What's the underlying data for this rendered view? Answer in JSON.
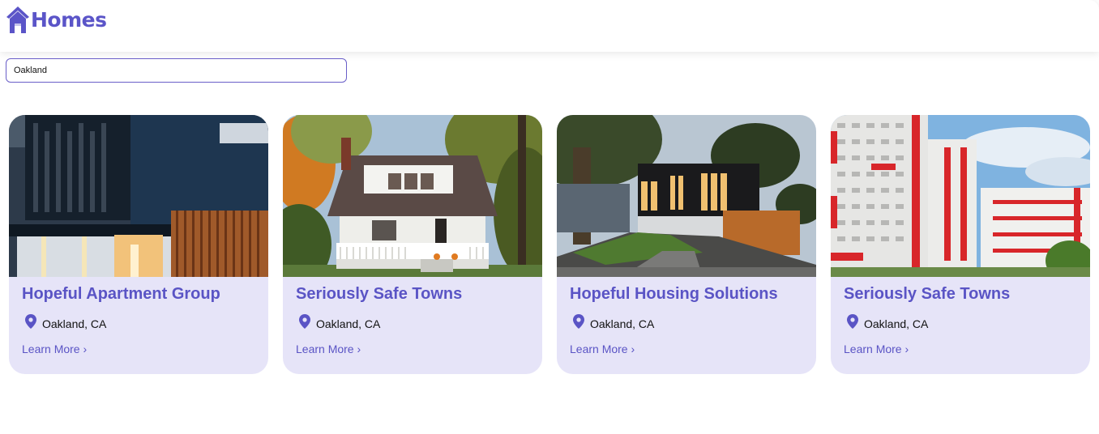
{
  "header": {
    "brand_name": "Homes",
    "brand_color": "#5b55c8"
  },
  "search": {
    "value": "Oakland"
  },
  "cards": [
    {
      "title": "Hopeful Apartment Group",
      "location": "Oakland, CA",
      "link": "Learn More ›",
      "image": "modern-dark-house-photo"
    },
    {
      "title": "Seriously Safe Towns",
      "location": "Oakland, CA",
      "link": "Learn More ›",
      "image": "white-porch-house-photo"
    },
    {
      "title": "Hopeful Housing Solutions",
      "location": "Oakland, CA",
      "link": "Learn More ›",
      "image": "modern-house-evening-photo"
    },
    {
      "title": "Seriously Safe Towns",
      "location": "Oakland, CA",
      "link": "Learn More ›",
      "image": "apartment-towers-photo"
    }
  ],
  "colors": {
    "accent": "#5a54c5",
    "card_bg": "#e6e4f8",
    "input_border": "#6a5fc8"
  }
}
